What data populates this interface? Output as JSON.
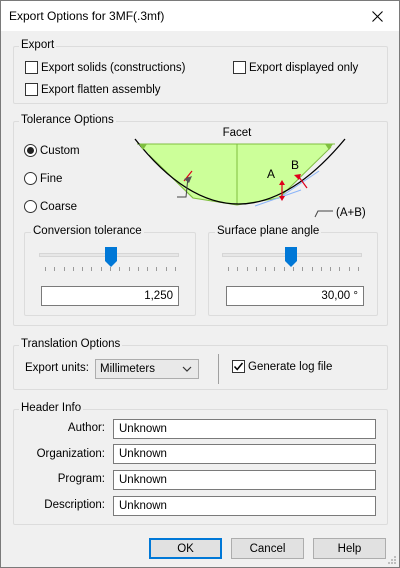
{
  "window": {
    "title": "Export Options for 3MF(.3mf)"
  },
  "export": {
    "legend": "Export",
    "solids_label": "Export solids (constructions)",
    "flatten_label": "Export flatten assembly",
    "displayed_label": "Export displayed only",
    "solids_checked": false,
    "flatten_checked": false,
    "displayed_checked": false
  },
  "tolerance": {
    "legend": "Tolerance Options",
    "options": [
      "Custom",
      "Fine",
      "Coarse"
    ],
    "selected": "Custom",
    "diagram": {
      "title": "Facet",
      "label_a": "A",
      "label_b": "B",
      "label_ab": "(A+B)"
    },
    "conversion": {
      "label": "Conversion tolerance",
      "value": "1,250",
      "slider_fraction": 0.5
    },
    "surface": {
      "label": "Surface plane angle",
      "value": "30,00 °",
      "slider_fraction": 0.5
    }
  },
  "translation": {
    "legend": "Translation Options",
    "units_label": "Export units:",
    "units_value": "Millimeters",
    "log_label": "Generate log file",
    "log_checked": true
  },
  "header": {
    "legend": "Header Info",
    "fields": [
      {
        "label": "Author:",
        "value": "Unknown"
      },
      {
        "label": "Organization:",
        "value": "Unknown"
      },
      {
        "label": "Program:",
        "value": "Unknown"
      },
      {
        "label": "Description:",
        "value": "Unknown"
      }
    ]
  },
  "buttons": {
    "ok": "OK",
    "cancel": "Cancel",
    "help": "Help"
  },
  "colors": {
    "accent": "#0078d7",
    "facet_fill": "#ccff99",
    "facet_line": "#7fbf3f",
    "marker": "#e0001b"
  }
}
